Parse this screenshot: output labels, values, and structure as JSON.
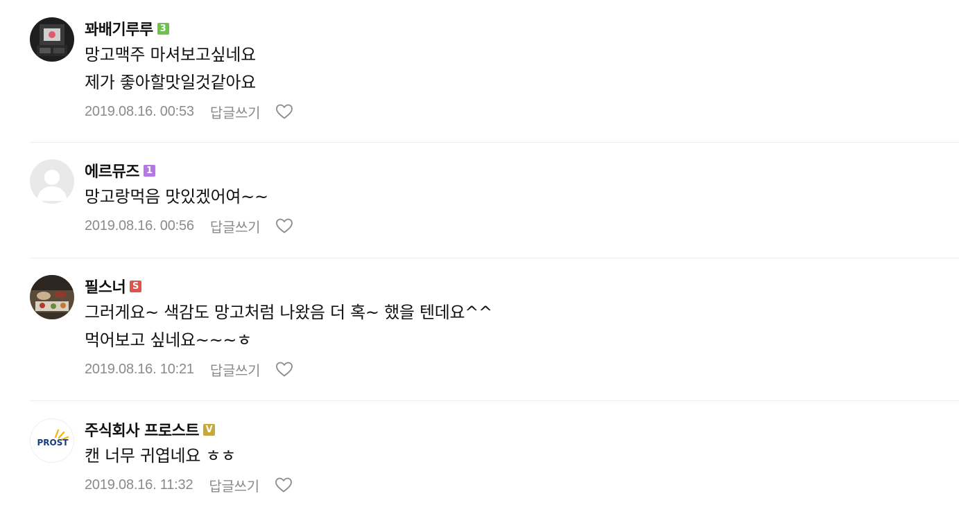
{
  "comments": [
    {
      "nickname": "꽈배기루루",
      "badge": {
        "text": "3",
        "color": "#6cc24a"
      },
      "lines": [
        "망고맥주 마셔보고싶네요",
        "제가 좋아할맛일것같아요"
      ],
      "date": "2019.08.16. 00:53",
      "reply_label": "답글쓰기"
    },
    {
      "nickname": "에르뮤즈",
      "badge": {
        "text": "1",
        "color": "#b378e6"
      },
      "lines": [
        "망고랑먹음 맛있겠어여~~"
      ],
      "date": "2019.08.16. 00:56",
      "reply_label": "답글쓰기"
    },
    {
      "nickname": "필스너",
      "badge": {
        "text": "S",
        "color": "#e0524a"
      },
      "lines": [
        "그러게요~ 색감도 망고처럼 나왔음 더 혹~ 했을 텐데요^^",
        "먹어보고 싶네요~~~ㅎ"
      ],
      "date": "2019.08.16. 10:21",
      "reply_label": "답글쓰기"
    },
    {
      "nickname": "주식회사 프로스트",
      "badge": {
        "text": "V",
        "color": "#c9a83a"
      },
      "lines": [
        "캔 너무 귀엽네요 ㅎㅎ"
      ],
      "date": "2019.08.16. 11:32",
      "reply_label": "답글쓰기"
    }
  ],
  "avatars": {
    "prost_logo_text": "PROST"
  },
  "icons": {
    "like": "heart-outline-icon",
    "default_avatar": "user-silhouette-icon"
  }
}
